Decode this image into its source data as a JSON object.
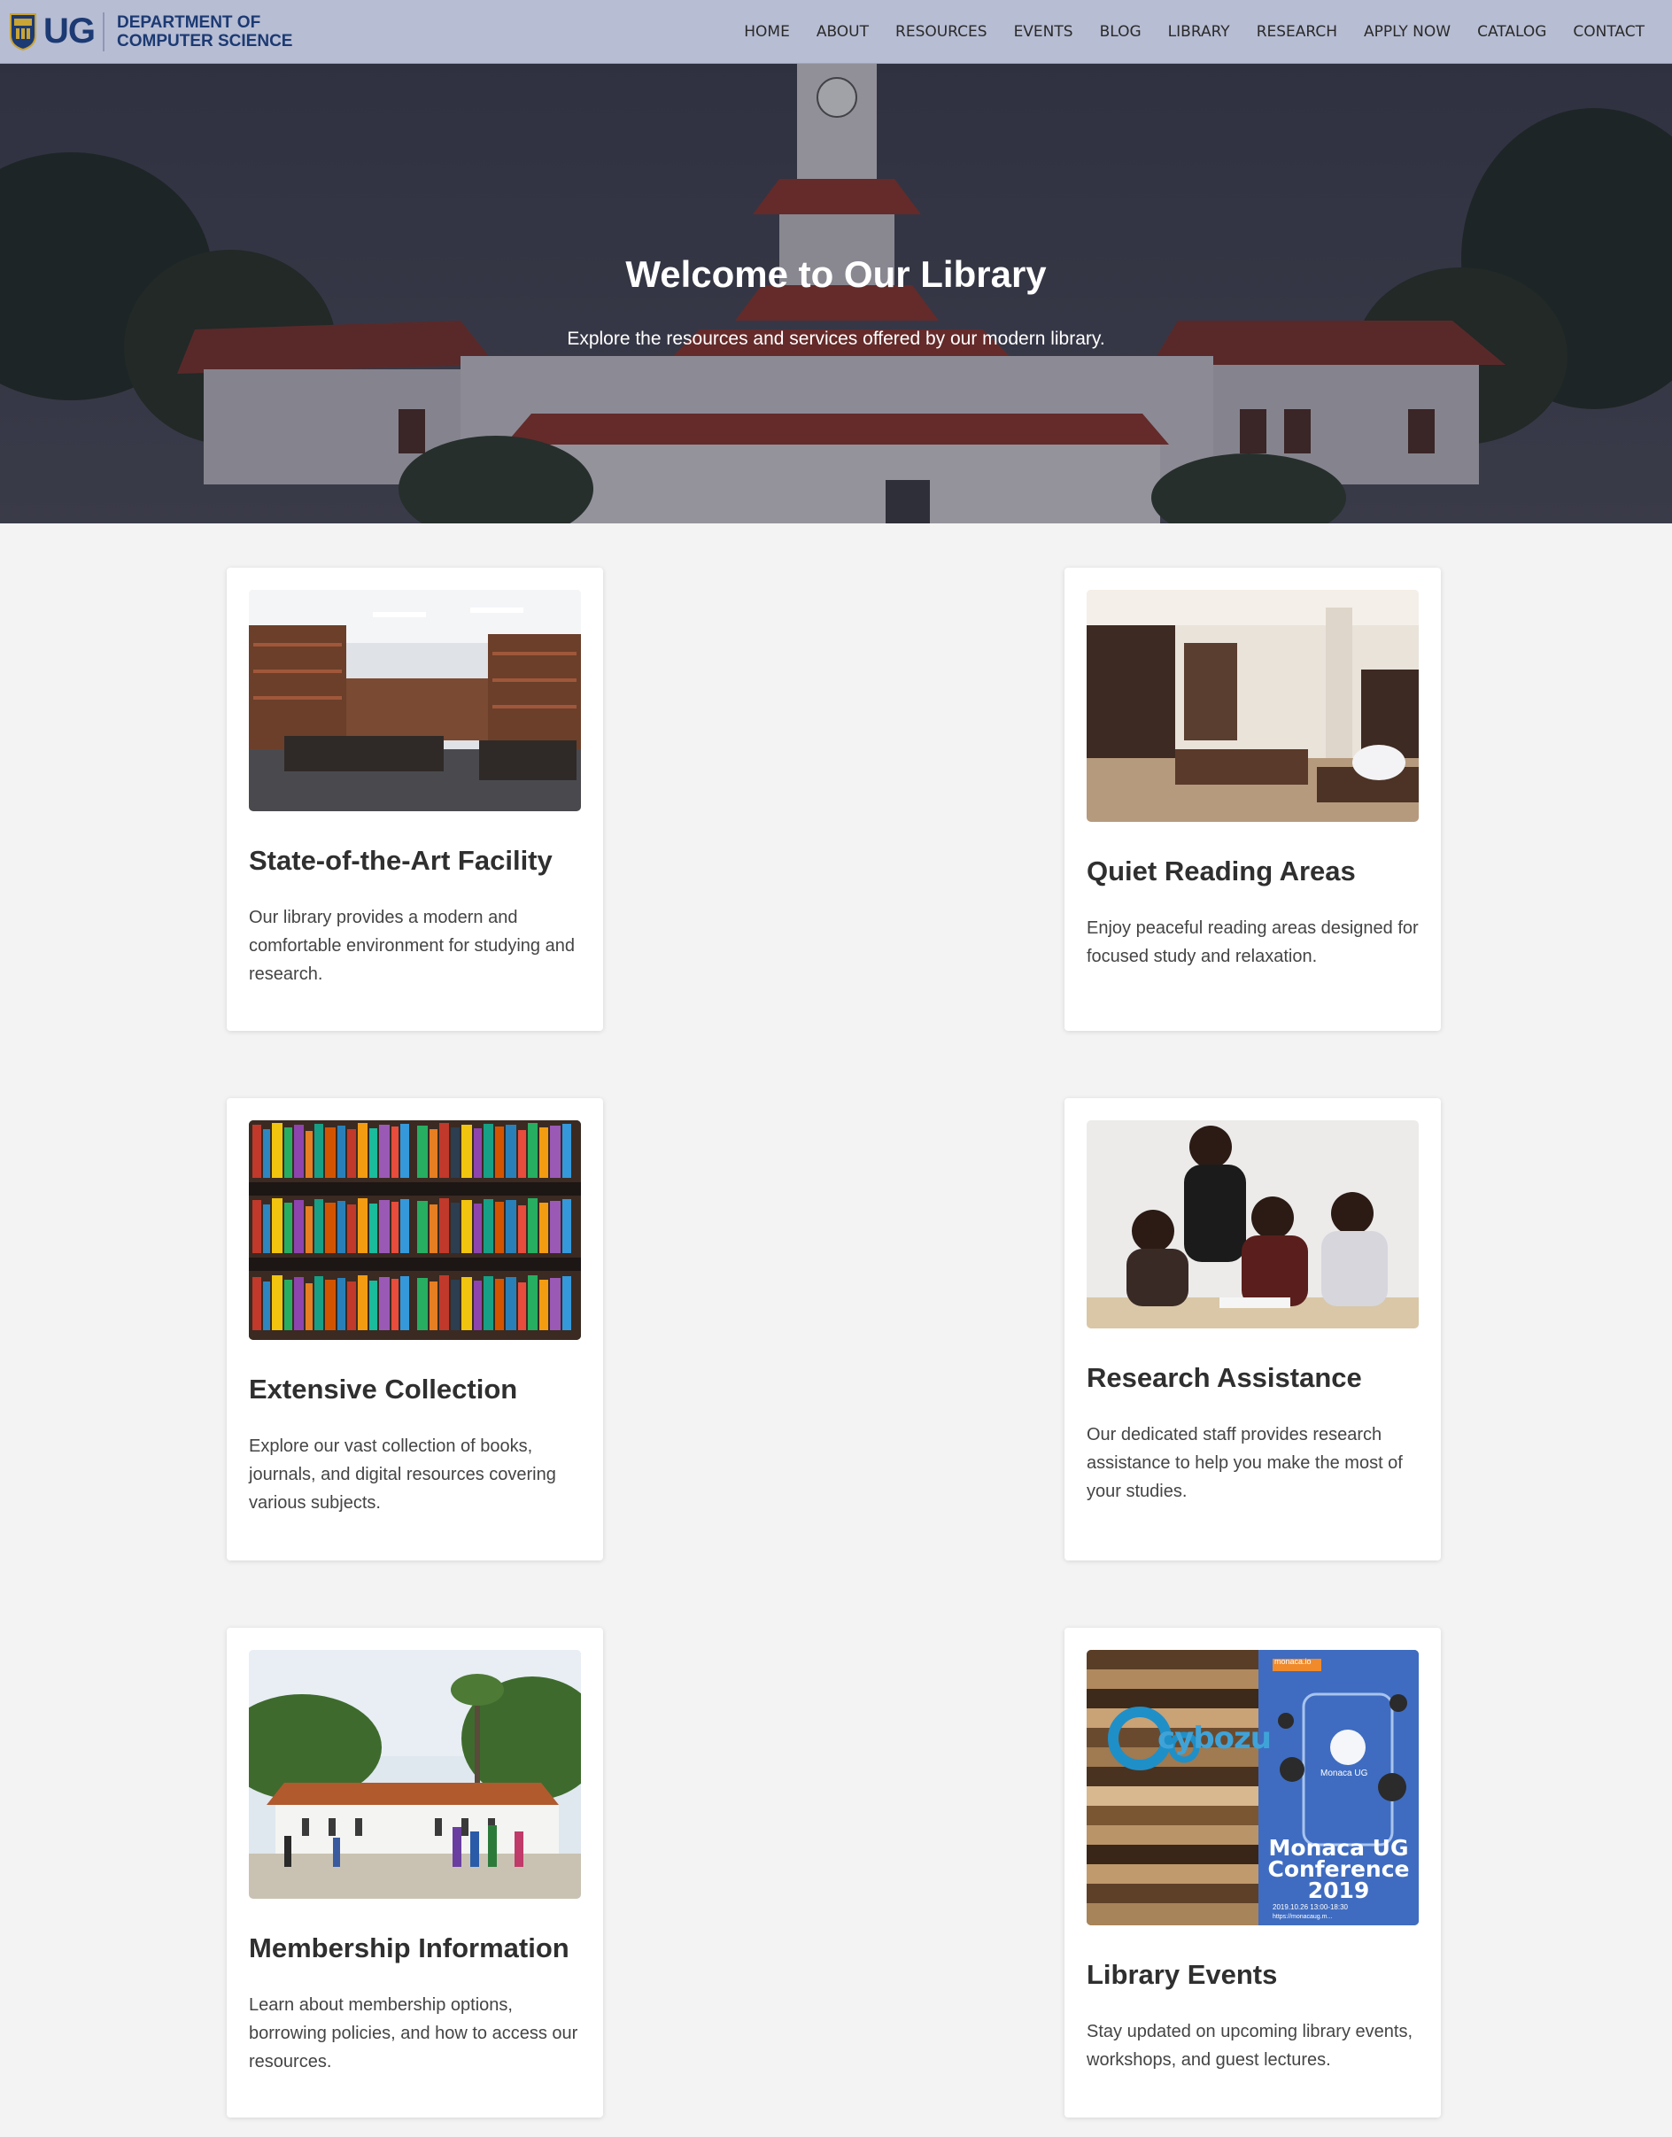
{
  "brand": {
    "logo_letters": "UG",
    "line1": "DEPARTMENT OF",
    "line2": "COMPUTER SCIENCE"
  },
  "nav": {
    "items": [
      "HOME",
      "ABOUT",
      "RESOURCES",
      "EVENTS",
      "BLOG",
      "LIBRARY",
      "RESEARCH",
      "APPLY NOW",
      "CATALOG",
      "CONTACT"
    ]
  },
  "hero": {
    "title": "Welcome to Our Library",
    "subtitle": "Explore the resources and services offered by our modern library."
  },
  "cards": [
    {
      "title": "State-of-the-Art Facility",
      "text": "Our library provides a modern and comfortable environment for studying and research.",
      "image": "library-hall-photo"
    },
    {
      "title": "Quiet Reading Areas",
      "text": "Enjoy peaceful reading areas designed for focused study and relaxation.",
      "image": "reading-room-photo"
    },
    {
      "title": "Extensive Collection",
      "text": "Explore our vast collection of books, journals, and digital resources covering various subjects.",
      "image": "bookshelf-photo"
    },
    {
      "title": "Research Assistance",
      "text": "Our dedicated staff provides research assistance to help you make the most of your studies.",
      "image": "students-studying-photo"
    },
    {
      "title": "Membership Information",
      "text": "Learn about membership options, borrowing policies, and how to access our resources.",
      "image": "campus-building-photo"
    },
    {
      "title": "Library Events",
      "text": "Stay updated on upcoming library events, workshops, and guest lectures.",
      "image": "conference-banner-photo",
      "poster": {
        "tag": "monaca.io",
        "brand": "cybozu",
        "app_label": "Monaca UG",
        "line1": "Monaca UG",
        "line2": "Conference",
        "line3": "2019",
        "date": "2019.10.26  13:00-18:30",
        "url": "https://monacaug.m..."
      }
    }
  ]
}
